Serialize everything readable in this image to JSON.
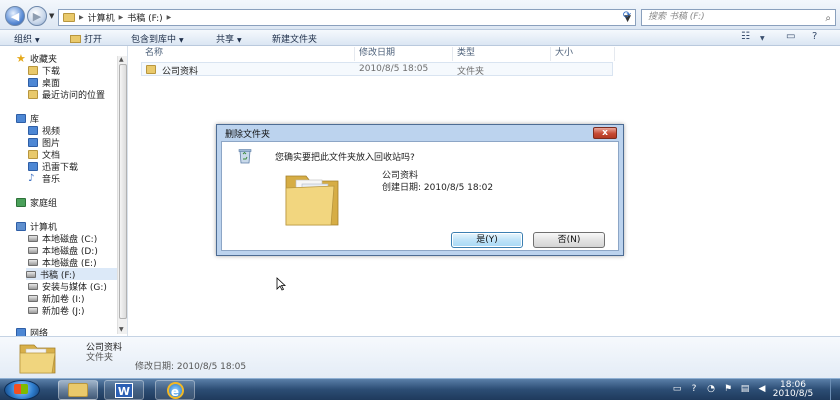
{
  "address": {
    "path": [
      "计算机",
      "书稿 (F:)"
    ],
    "search_placeholder": "搜索 书稿 (F:)"
  },
  "toolbar": {
    "organize": "组织",
    "open": "打开",
    "include_library": "包含到库中",
    "share": "共享",
    "new_folder": "新建文件夹"
  },
  "nav": {
    "favorites": "收藏夹",
    "downloads": "下载",
    "desktop": "桌面",
    "recent": "最近访问的位置",
    "libraries": "库",
    "videos": "视频",
    "pictures": "图片",
    "documents": "文档",
    "thunder": "迅雷下载",
    "music": "音乐",
    "homegroup": "家庭组",
    "computer": "计算机",
    "drive_c": "本地磁盘 (C:)",
    "drive_d": "本地磁盘 (D:)",
    "drive_e": "本地磁盘 (E:)",
    "drive_f": "书稿 (F:)",
    "drive_g": "安装与媒体 (G:)",
    "drive_i": "新加卷 (I:)",
    "drive_j": "新加卷 (J:)",
    "network": "网络"
  },
  "columns": {
    "name": "名称",
    "modified": "修改日期",
    "type": "类型",
    "size": "大小"
  },
  "file": {
    "name": "公司资料",
    "modified": "2010/8/5 18:05",
    "type": "文件夹"
  },
  "details": {
    "name": "公司资料",
    "type": "文件夹",
    "modified": "修改日期: 2010/8/5 18:05"
  },
  "dialog": {
    "title": "删除文件夹",
    "close": "x",
    "question": "您确实要把此文件夹放入回收站吗?",
    "folder_name": "公司资料",
    "created": "创建日期: 2010/8/5 18:02",
    "yes": "是(Y)",
    "no": "否(N)"
  },
  "taskbar": {
    "time": "18:06",
    "date": "2010/8/5",
    "word_letter": "W",
    "ie_letter": "e"
  },
  "colors": {
    "accent": "#2f6bc2",
    "folder": "#e9c96b",
    "dialog_frame": "#bcd3ee",
    "taskbar": "#2c4d74"
  }
}
